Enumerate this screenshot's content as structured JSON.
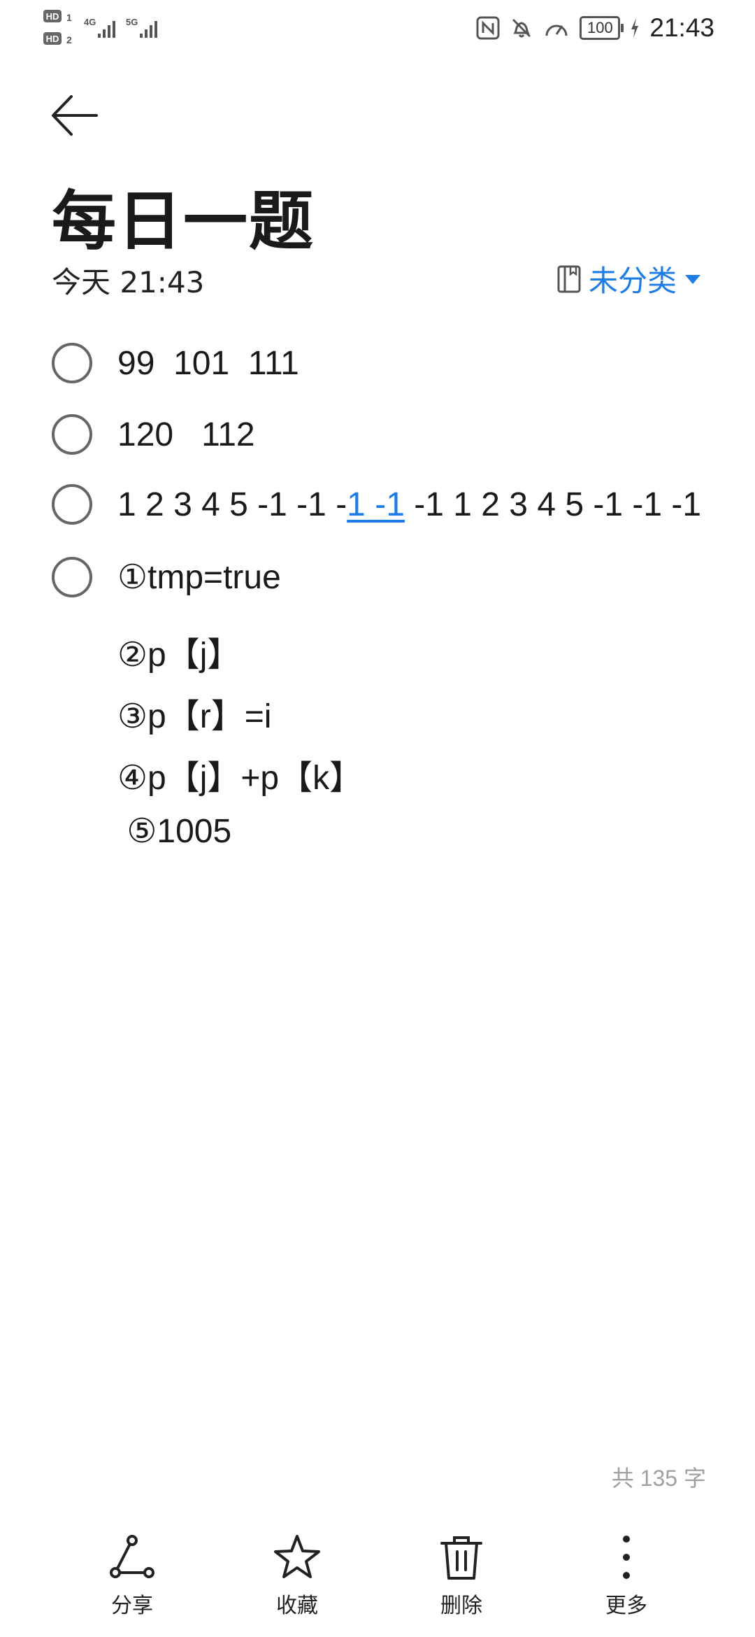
{
  "status_bar": {
    "time": "21:43",
    "battery": "100",
    "left_labels": [
      "HD",
      "1",
      "4G",
      "5G",
      "HD",
      "2"
    ],
    "icons": [
      "nfc-icon",
      "mute-icon",
      "speedometer-icon",
      "battery-icon",
      "charging-icon"
    ]
  },
  "note": {
    "title": "每日一题",
    "time": "今天 21:43",
    "category": "未分类"
  },
  "todos": [
    {
      "text": "99  101  111"
    },
    {
      "text": "120   112"
    },
    {
      "before": "1 2 3 4 5 -1 -1 -",
      "link": "1 -1",
      "after": " -1 1 2 3 4 5 -1 -1 -1"
    },
    {
      "text": "①tmp=true"
    }
  ],
  "lines": [
    "②p【j】",
    "③p【r】=i",
    "④p【j】+p【k】",
    " ⑤1005"
  ],
  "word_count": "共 135 字",
  "toolbar": {
    "share": "分享",
    "favorite": "收藏",
    "delete": "删除",
    "more": "更多"
  },
  "colors": {
    "accent": "#1e7ce6",
    "text": "#1a1a1a",
    "muted": "#a0a0a0"
  }
}
